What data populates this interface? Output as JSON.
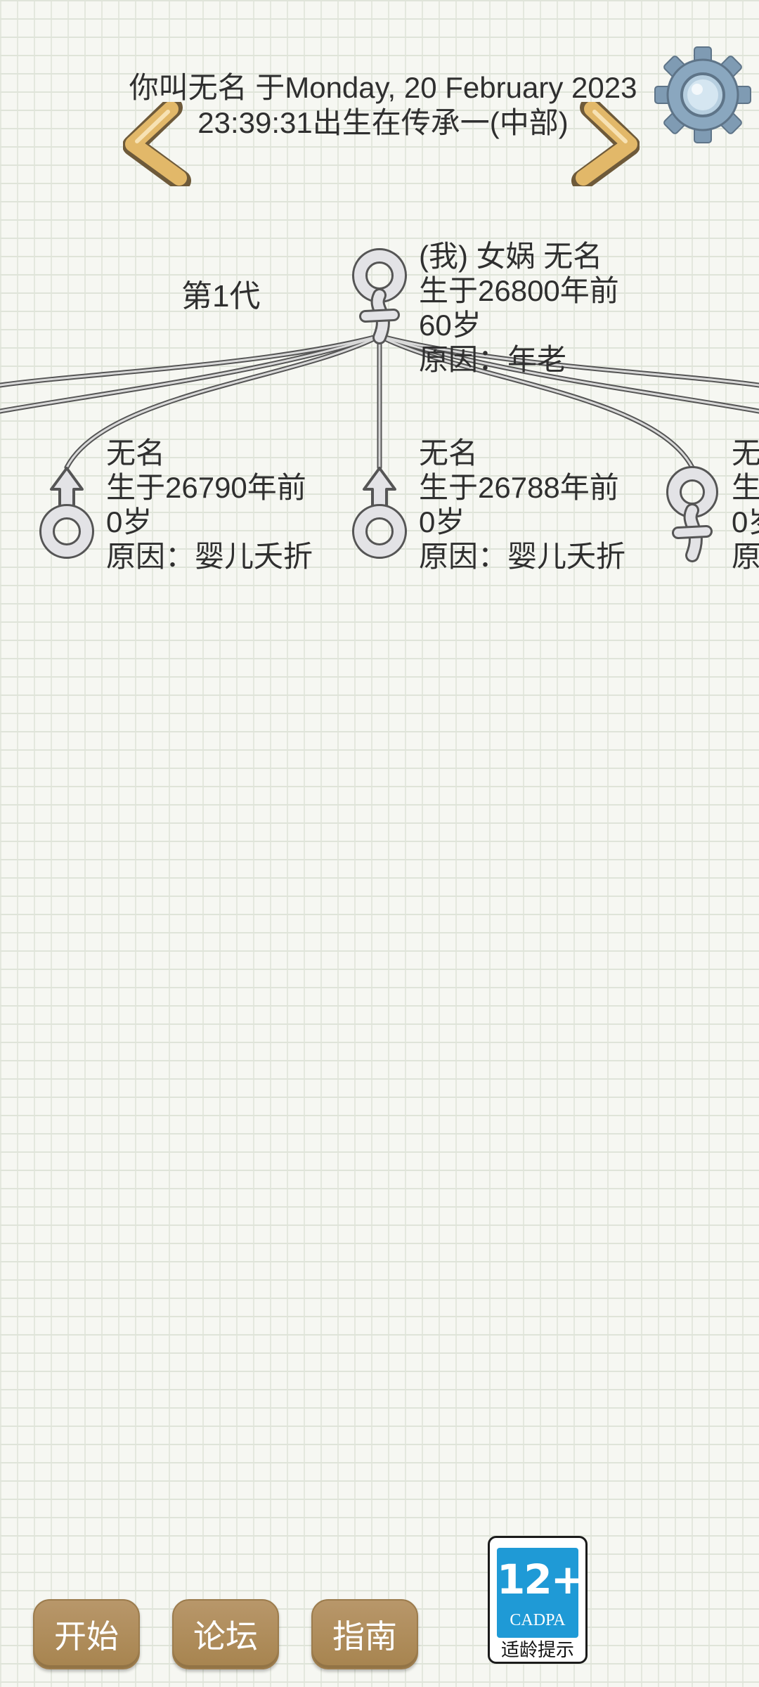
{
  "header": {
    "line1": "你叫无名 于Monday, 20 February 2023",
    "line2": "23:39:31出生在传承一(中部)"
  },
  "generation": {
    "label": "第1代"
  },
  "nodes": {
    "self": {
      "gender": "female",
      "line1": "(我) 女娲 无名",
      "line2": "生于26800年前",
      "line3": "60岁",
      "line4": "原因：年老"
    },
    "child1": {
      "gender": "male",
      "line1": "无名",
      "line2": "生于26790年前",
      "line3": "0岁",
      "line4": "原因：婴儿夭折"
    },
    "child2": {
      "gender": "male",
      "line1": "无名",
      "line2": "生于26788年前",
      "line3": "0岁",
      "line4": "原因：婴儿夭折"
    },
    "child3": {
      "gender": "female",
      "line1": "无",
      "line2": "生",
      "line3": "0岁",
      "line4": "原"
    }
  },
  "bottom_nav": {
    "start": "开始",
    "forum": "论坛",
    "guide": "指南"
  },
  "age_badge": {
    "rating": "12+",
    "org": "CADPA",
    "note": "适龄提示",
    "color": "#1f9ad6"
  },
  "colors": {
    "button": "#ad8b58",
    "arrow": "#e2b869",
    "gear": "#8aa7bf",
    "background": "#f6f7f2"
  }
}
